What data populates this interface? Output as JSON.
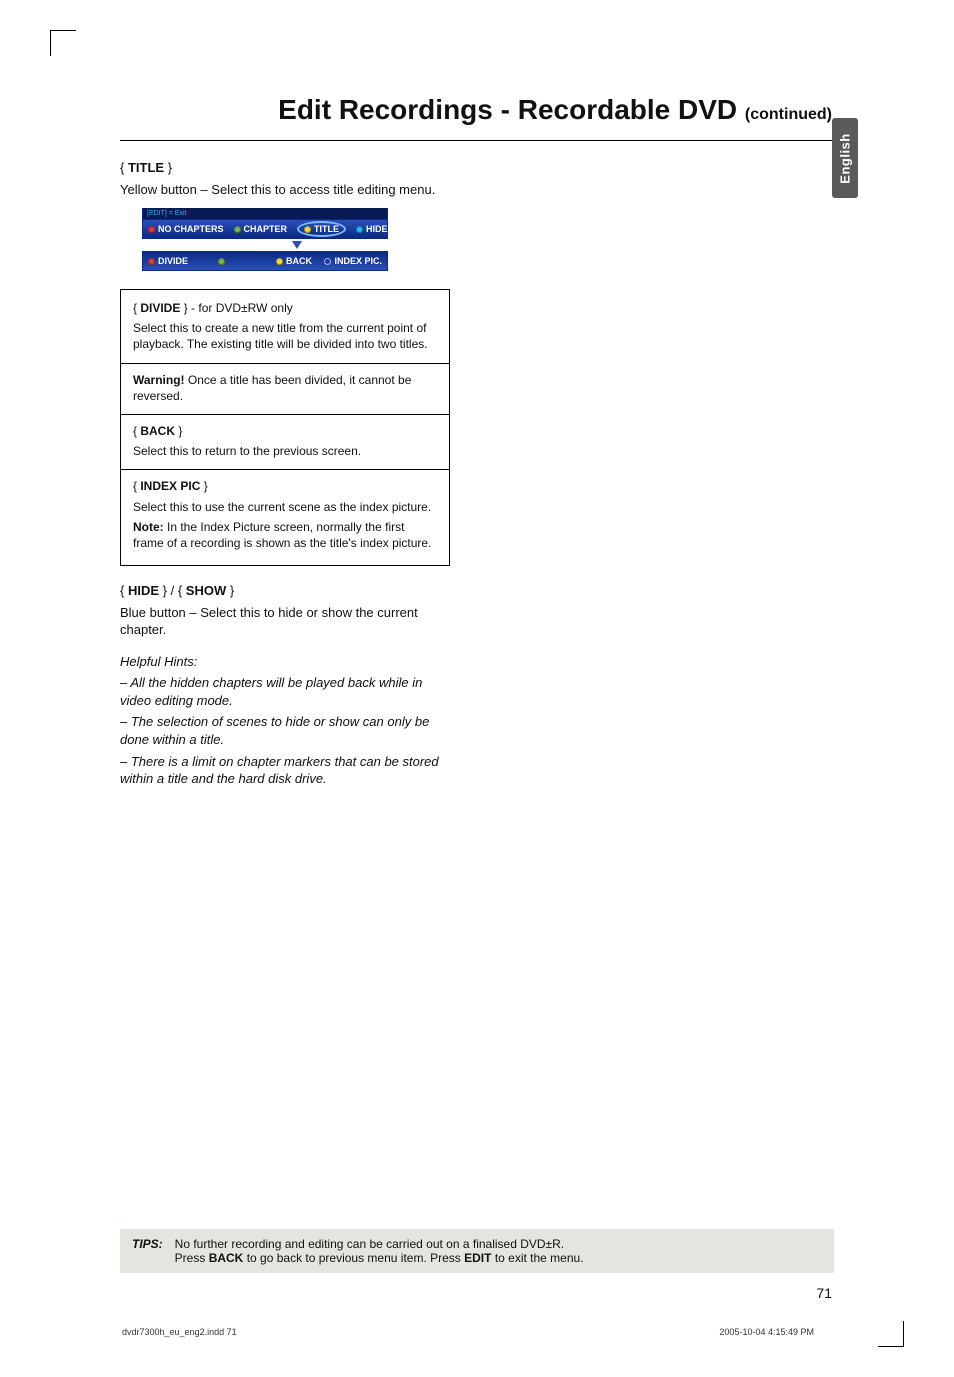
{
  "header": {
    "title_main": "Edit Recordings - Recordable DVD ",
    "title_cont": "(continued)"
  },
  "side_tab": "English",
  "section_title": {
    "brace_open": "{ ",
    "label": "TITLE",
    "brace_close": " }",
    "desc": "Yellow button – Select this to access title editing menu."
  },
  "menu": {
    "edit_exit": "[EDIT] = Exit",
    "top": {
      "a": "NO CHAPTERS",
      "b": "CHAPTER",
      "c": "TITLE",
      "d": "HIDE"
    },
    "bot": {
      "a": "DIVIDE",
      "b": "",
      "c": "BACK",
      "d": "INDEX PIC."
    }
  },
  "box": {
    "divide": {
      "title_pre": " { ",
      "title": "DIVIDE",
      "title_post": " } - for DVD±RW only",
      "body": "Select this to create a new title from the current point of playback. The existing title will be divided into two titles.",
      "warn_label": "Warning! ",
      "warn_body": "Once a title has been divided, it cannot be reversed."
    },
    "back": {
      "title_pre": " { ",
      "title": "BACK",
      "title_post": " }",
      "body": "Select this to return to the previous screen."
    },
    "index": {
      "title_pre": " { ",
      "title": "INDEX PIC",
      "title_post": " }",
      "body1": "Select this to use the current scene as the index picture.",
      "note_label": "Note: ",
      "note_body": "In the Index Picture screen, normally the first frame of a recording is shown as the title's index picture."
    }
  },
  "hide_show": {
    "lbrace1": "{ ",
    "hide": "HIDE",
    "mid": " } / { ",
    "show": "SHOW",
    "rbrace2": " }",
    "desc": "Blue button – Select this to hide or show the current chapter."
  },
  "hints": {
    "heading": "Helpful Hints:",
    "h1": "–  All the hidden chapters will be played back while in video editing mode.",
    "h2": "–  The selection of scenes to hide or show can only be done within a title.",
    "h3": "–  There is a limit on chapter markers that can be stored within a title and the hard disk drive."
  },
  "tips": {
    "label": "TIPS:",
    "line1a": "No further recording and editing can be carried out on a finalised DVD±R.",
    "line2a": "Press ",
    "line2b": "BACK",
    "line2c": " to go back to previous menu item. Press ",
    "line2d": "EDIT",
    "line2e": " to exit the menu."
  },
  "page_number": "71",
  "footer": {
    "left": "dvdr7300h_eu_eng2.indd   71",
    "right": "2005-10-04   4:15:49 PM"
  }
}
